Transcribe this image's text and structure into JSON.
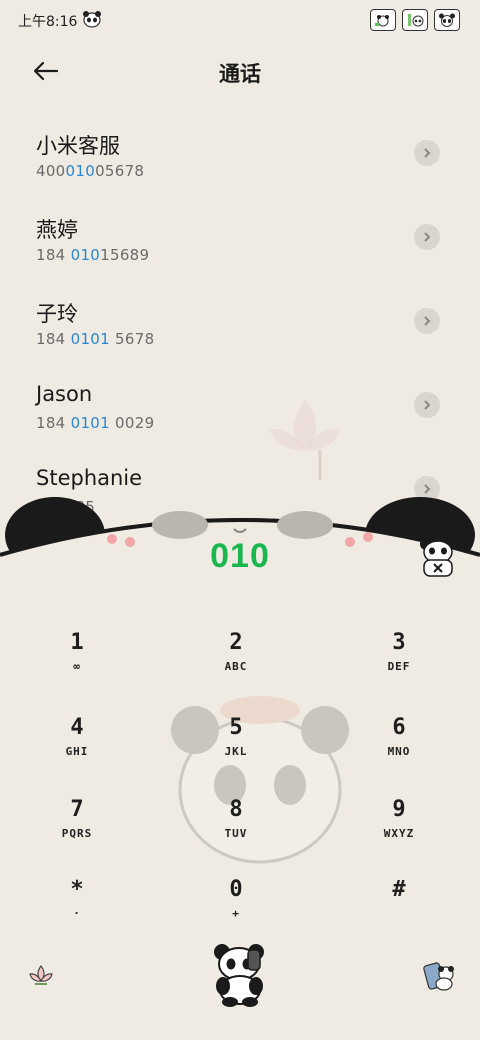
{
  "status": {
    "time": "上午8:16",
    "panda_icon": "panda-icon",
    "right_icons": [
      "panda-app-icon",
      "bamboo-panda-icon",
      "panda-face-icon"
    ]
  },
  "header": {
    "title": "通话",
    "back_icon": "arrow-left-icon"
  },
  "contacts": [
    {
      "name": "小米客服",
      "num_pre": "400",
      "num_hl": "010",
      "num_post": "05678"
    },
    {
      "name": "燕婷",
      "num_pre": "184 ",
      "num_hl": "010",
      "num_post": "15689"
    },
    {
      "name": "子玲",
      "num_pre": "184 ",
      "num_hl": "0101",
      "num_post": " 5678"
    },
    {
      "name": "Jason",
      "num_pre": "184 ",
      "num_hl": "0101",
      "num_post": " 0029"
    },
    {
      "name": "Stephanie",
      "num_pre": "18",
      "num_hl": "",
      "num_post": "4685"
    }
  ],
  "dialer": {
    "input": "010",
    "highlight_color": "#2a86d6",
    "input_color": "#1cb64f"
  },
  "keys": [
    {
      "digit": "1",
      "letters": "∞"
    },
    {
      "digit": "2",
      "letters": "ABC"
    },
    {
      "digit": "3",
      "letters": "DEF"
    },
    {
      "digit": "4",
      "letters": "GHI"
    },
    {
      "digit": "5",
      "letters": "JKL"
    },
    {
      "digit": "6",
      "letters": "MNO"
    },
    {
      "digit": "7",
      "letters": "PQRS"
    },
    {
      "digit": "8",
      "letters": "TUV"
    },
    {
      "digit": "9",
      "letters": "WXYZ"
    },
    {
      "digit": "*",
      "letters": "·"
    },
    {
      "digit": "0",
      "letters": "+"
    },
    {
      "digit": "#",
      "letters": ""
    }
  ],
  "bottom": {
    "left_icon": "lotus-icon",
    "call_icon": "panda-phone-call-icon",
    "right_icon": "panda-contacts-icon"
  }
}
